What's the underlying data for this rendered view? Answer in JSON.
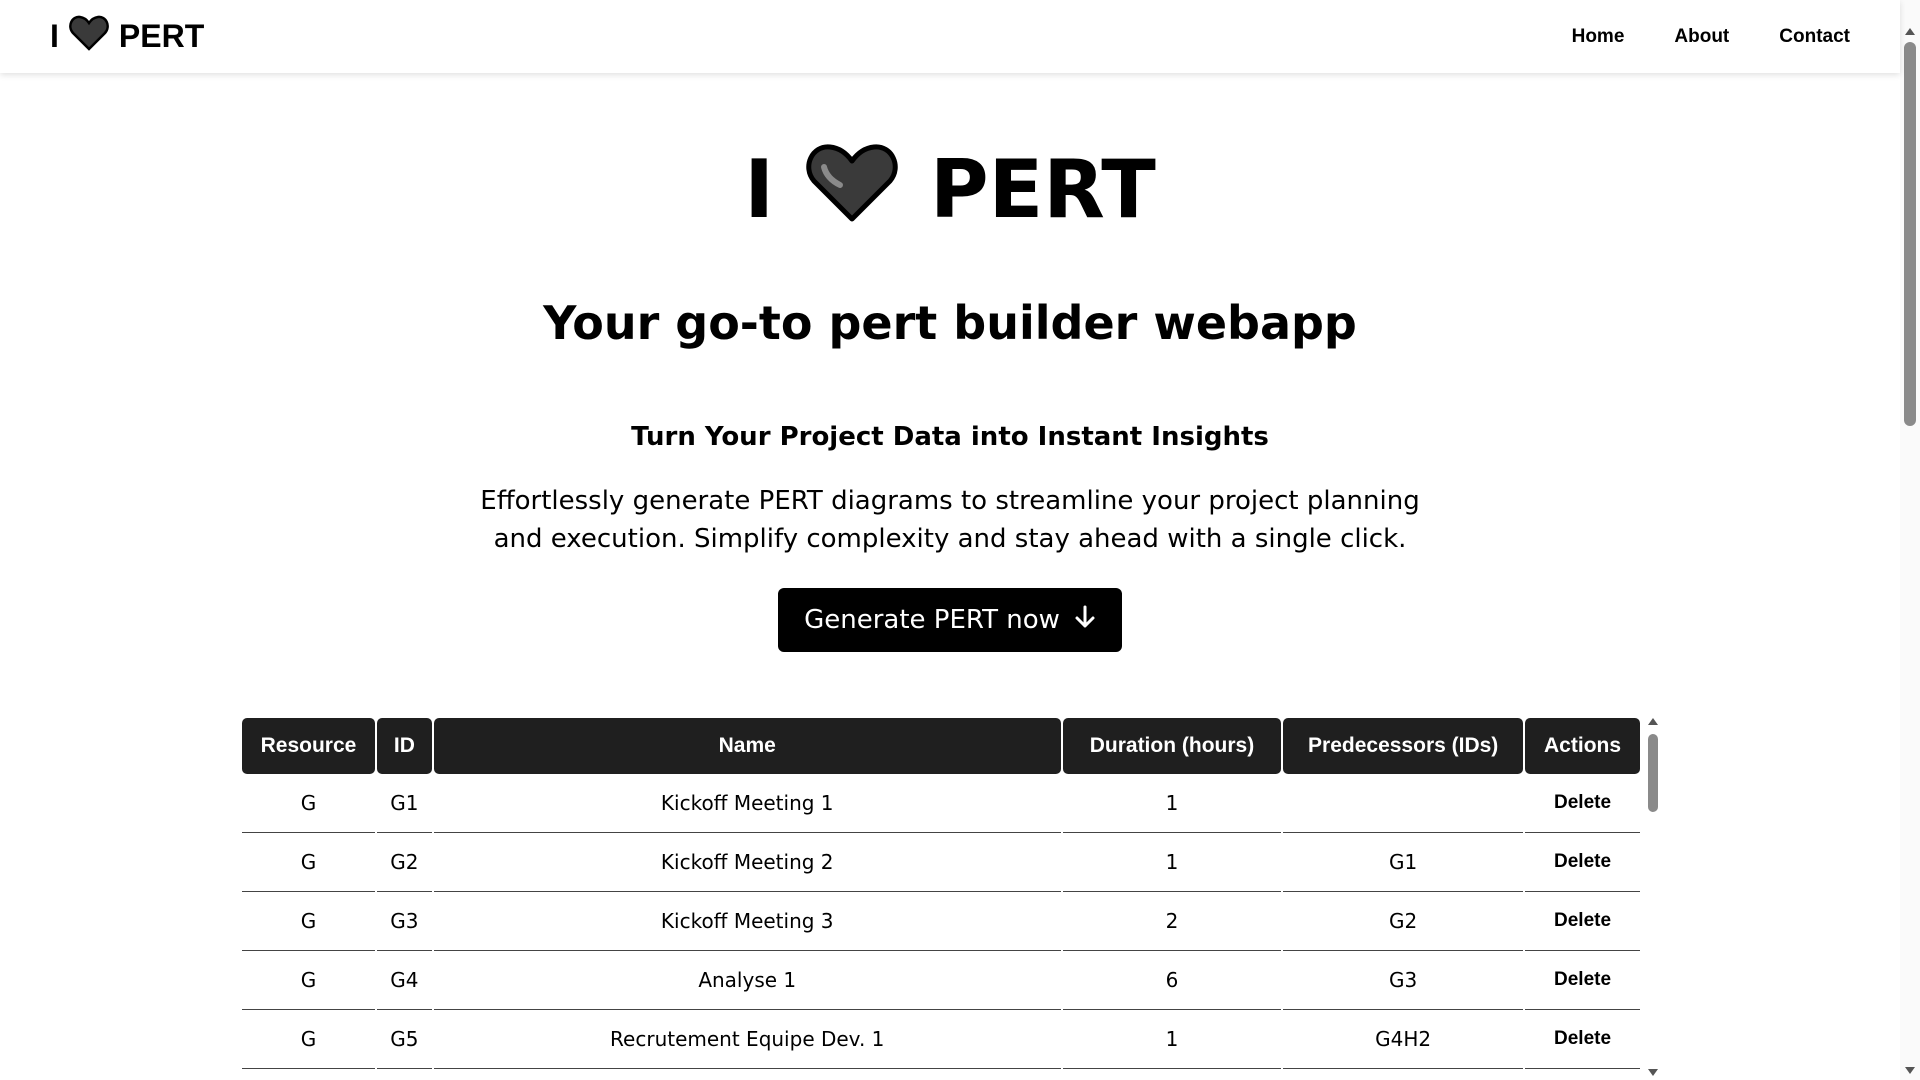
{
  "navbar": {
    "brand_prefix": "I",
    "brand_suffix": "PERT",
    "brand_icon": "heart-icon",
    "links": [
      "Home",
      "About",
      "Contact"
    ]
  },
  "hero": {
    "title_prefix": "I",
    "title_suffix": "PERT",
    "title_icon": "heart-icon",
    "tagline": "Your go-to pert builder webapp",
    "subheading": "Turn Your Project Data into Instant Insights",
    "description": "Effortlessly generate PERT diagrams to streamline your project planning and execution. Simplify complexity and stay ahead with a single click.",
    "cta_label": "Generate PERT now",
    "cta_icon": "arrow-down-icon"
  },
  "table": {
    "headers": [
      "Resource",
      "ID",
      "Name",
      "Duration (hours)",
      "Predecessors (IDs)",
      "Actions"
    ],
    "rows": [
      {
        "resource": "G",
        "id": "G1",
        "name": "Kickoff Meeting 1",
        "duration": "1",
        "predecessors": "",
        "action": "Delete"
      },
      {
        "resource": "G",
        "id": "G2",
        "name": "Kickoff Meeting 2",
        "duration": "1",
        "predecessors": "G1",
        "action": "Delete"
      },
      {
        "resource": "G",
        "id": "G3",
        "name": "Kickoff Meeting 3",
        "duration": "2",
        "predecessors": "G2",
        "action": "Delete"
      },
      {
        "resource": "G",
        "id": "G4",
        "name": "Analyse 1",
        "duration": "6",
        "predecessors": "G3",
        "action": "Delete"
      },
      {
        "resource": "G",
        "id": "G5",
        "name": "Recrutement Equipe Dev. 1",
        "duration": "1",
        "predecessors": "G4H2",
        "action": "Delete"
      }
    ]
  },
  "colors": {
    "accent": "#000000",
    "header_bg": "#1f1f1f",
    "heart": "#3a3a3a"
  }
}
